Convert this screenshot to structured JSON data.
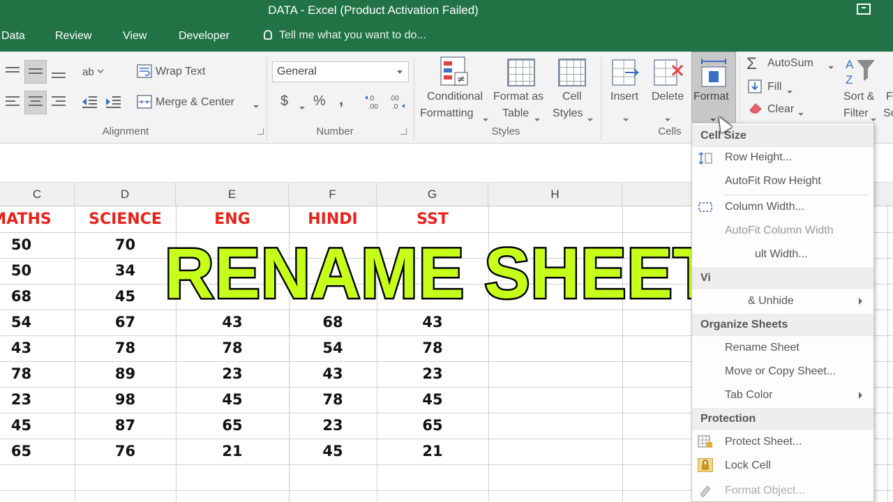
{
  "window": {
    "title": "DATA - Excel (Product Activation Failed)"
  },
  "tabs": [
    "Data",
    "Review",
    "View",
    "Developer"
  ],
  "tellme": "Tell me what you want to do...",
  "ribbon": {
    "alignment": {
      "wrap_text": "Wrap Text",
      "merge_center": "Merge & Center",
      "label": "Alignment"
    },
    "number": {
      "format": "General",
      "currency": "$",
      "percent": "%",
      "comma": ",",
      "inc_decimal": "←.0 .00",
      "dec_decimal": ".00 →.0",
      "label": "Number"
    },
    "styles": {
      "conditional": [
        "Conditional",
        "Formatting"
      ],
      "format_table": [
        "Format as",
        "Table"
      ],
      "cell_styles": [
        "Cell",
        "Styles"
      ],
      "label": "Styles"
    },
    "cells": {
      "insert": "Insert",
      "delete": "Delete",
      "format": "Format",
      "label": "Cells"
    },
    "editing": {
      "autosum": "AutoSum",
      "fill": "Fill",
      "clear": "Clear",
      "sort_filter": [
        "Sort &",
        "Filter"
      ],
      "find_partial": [
        "F",
        "Se"
      ]
    }
  },
  "sheet": {
    "columns": [
      "C",
      "D",
      "E",
      "F",
      "G",
      "H"
    ],
    "headers": [
      "MATHS",
      "SCIENCE",
      "ENG",
      "HINDI",
      "SST"
    ],
    "rows": [
      [
        "50",
        "70",
        "",
        "",
        ""
      ],
      [
        "50",
        "34",
        "",
        "",
        ""
      ],
      [
        "68",
        "45",
        "",
        "",
        ""
      ],
      [
        "54",
        "67",
        "43",
        "68",
        "43"
      ],
      [
        "43",
        "78",
        "78",
        "54",
        "78"
      ],
      [
        "78",
        "89",
        "23",
        "43",
        "23"
      ],
      [
        "23",
        "98",
        "45",
        "78",
        "45"
      ],
      [
        "45",
        "87",
        "65",
        "23",
        "65"
      ],
      [
        "65",
        "76",
        "21",
        "45",
        "21"
      ]
    ]
  },
  "overlay_text": "RENAME SHEETS",
  "format_menu": {
    "cell_size": "Cell Size",
    "row_height": "Row Height...",
    "autofit_row": "AutoFit Row Height",
    "column_width": "Column Width...",
    "autofit_column": "AutoFit Column Width",
    "default_width": "ult Width...",
    "visibility_partial": "Vi",
    "hide_unhide": "& Unhide",
    "organize": "Organize Sheets",
    "rename": "Rename Sheet",
    "move_copy": "Move or Copy Sheet...",
    "tab_color": "Tab Color",
    "protection": "Protection",
    "protect_sheet": "Protect Sheet...",
    "lock_cell": "Lock Cell",
    "format_object": "Format Object..."
  },
  "colors": {
    "excel_green": "#217346",
    "header_red": "#e8221a",
    "overlay_lime": "#c6ff1a"
  }
}
